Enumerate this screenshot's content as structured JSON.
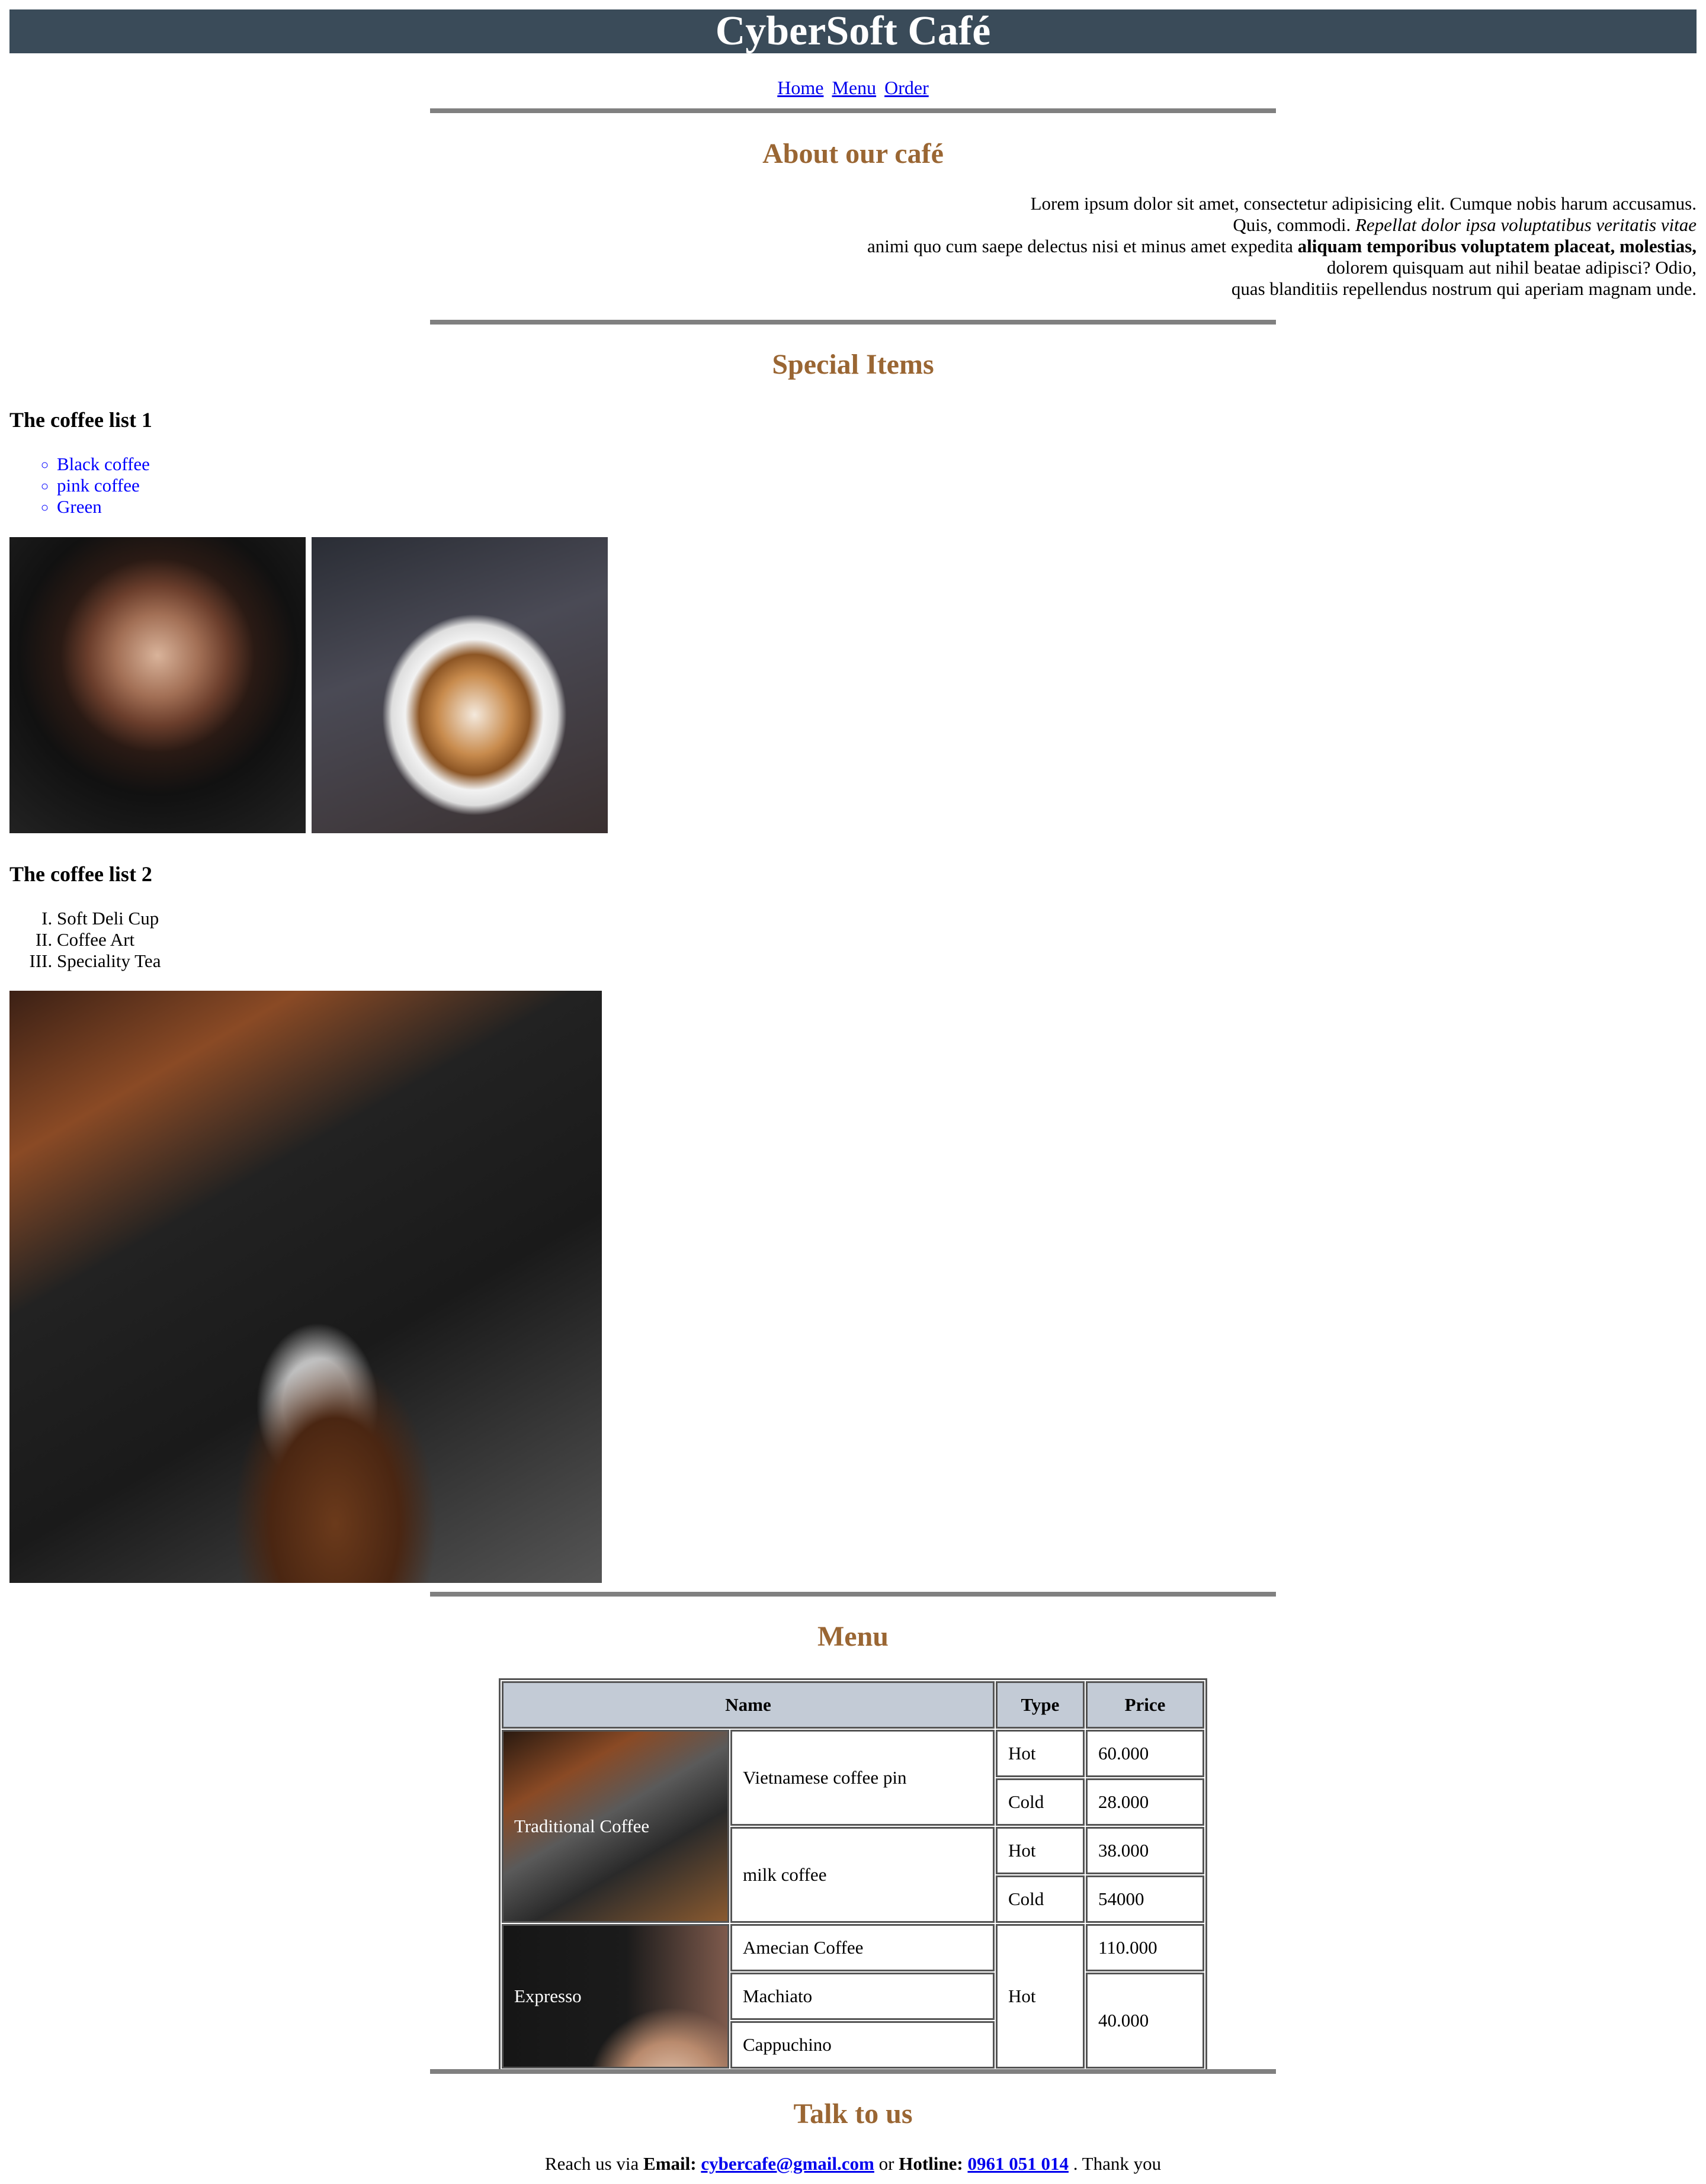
{
  "header": {
    "title": "CyberSoft Café",
    "bg_color": "#3a4b59"
  },
  "nav": {
    "items": [
      "Home",
      "Menu",
      "Order"
    ]
  },
  "about": {
    "title": "About our café",
    "line1": "Lorem ipsum dolor sit amet, consectetur adipisicing elit. Cumque nobis harum accusamus.",
    "line2_plain": "Quis, commodi. ",
    "line2_italic": "Repellat dolor ipsa voluptatibus veritatis vitae",
    "line3_plain": "animi quo cum saepe delectus nisi et minus amet expedita ",
    "line3_bold": "aliquam temporibus voluptatem placeat, molestias,",
    "line4": "dolorem quisquam aut nihil beatae adipisci? Odio,",
    "line5": "quas blanditiis repellendus nostrum qui aperiam magnam unde."
  },
  "special": {
    "title": "Special Items",
    "list1_title": "The coffee list 1",
    "list1": [
      "Black coffee",
      "pink coffee",
      "Green"
    ],
    "list2_title": "The coffee list 2",
    "list2": [
      "Soft Deli Cup",
      "Coffee Art",
      "Speciality Tea"
    ]
  },
  "menu": {
    "title": "Menu",
    "headers": {
      "name": "Name",
      "type": "Type",
      "price": "Price"
    },
    "groups": {
      "traditional": {
        "label": "Traditional Coffee",
        "items": {
          "pin": {
            "name": "Vietnamese coffee pin",
            "hot_type": "Hot",
            "hot_price": "60.000",
            "cold_type": "Cold",
            "cold_price": "28.000"
          },
          "milk": {
            "name": "milk coffee",
            "hot_type": "Hot",
            "hot_price": "38.000",
            "cold_type": "Cold",
            "cold_price": "54000"
          }
        }
      },
      "expresso": {
        "label": "Expresso",
        "type": "Hot",
        "items": {
          "americano": {
            "name": "Amecian Coffee",
            "price": "110.000"
          },
          "machiato": {
            "name": "Machiato"
          },
          "cappuchino": {
            "name": "Cappuchino"
          },
          "shared_price": "40.000"
        }
      }
    }
  },
  "contact": {
    "title": "Talk to us",
    "prefix": "Reach us via ",
    "email_label": "Email:",
    "email": "cybercafe@gmail.com",
    "or": " or ",
    "hotline_label": "Hotline:",
    "hotline": "0961 051 014",
    "suffix": " . Thank you"
  },
  "colors": {
    "heading": "#9a6633",
    "link": "#0000ee",
    "table_header": "#c3cbd6",
    "rule": "#808080"
  }
}
